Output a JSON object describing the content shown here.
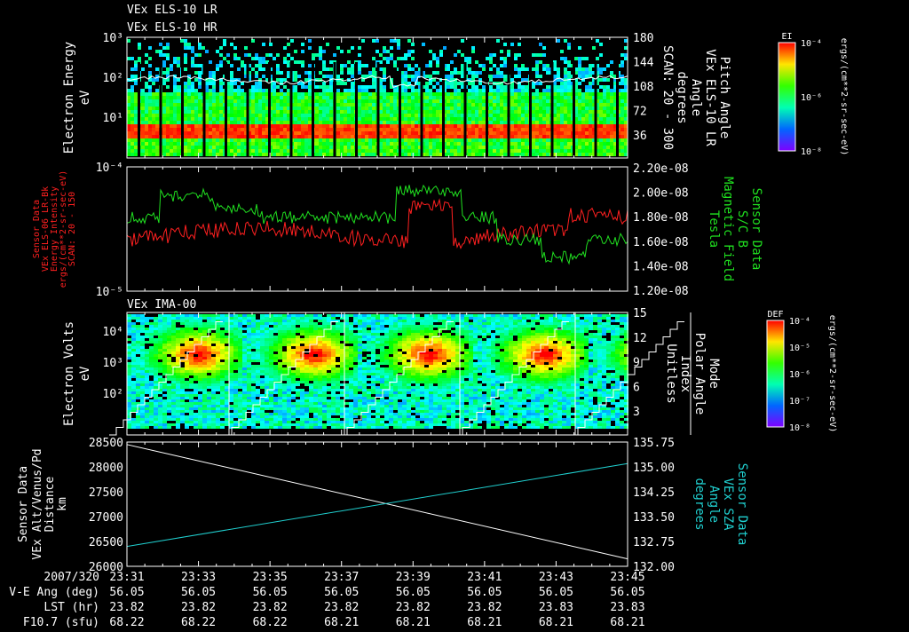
{
  "titles": {
    "top1": "VEx ELS-10 LR",
    "top2": "VEx ELS-10 HR",
    "ima": "VEx IMA-00"
  },
  "colors": {
    "red": "#ff2020",
    "green": "#20e020",
    "cyan": "#20d0d0",
    "white": "#ffffff"
  },
  "panel1": {
    "left_label": [
      "Electron Energy",
      "eV"
    ],
    "left_ticks": [
      "10³",
      "10²",
      "10¹"
    ],
    "right_ticks": [
      "180",
      "144",
      "108",
      "72",
      "36"
    ],
    "right_label": [
      "Pitch Angle",
      "VEx ELS-10 LR",
      "Angle",
      "degrees",
      "SCAN: 20 - 300"
    ],
    "colorbar": {
      "title": "EI",
      "ticks": [
        "10⁻⁴",
        "10⁻⁶",
        "10⁻⁸"
      ],
      "unit": "ergs/(cm**2-sr-sec-eV)"
    }
  },
  "panel2": {
    "left_ticks": [
      "10⁻⁴",
      "10⁻⁵"
    ],
    "left_label": [
      "Sensor Data",
      "VEx ELS-06 LR-Bk",
      "Energy Intensity",
      "ergs/(cm**2-sr-sec-eV)",
      "SCAN: 20 - 150"
    ],
    "right_ticks": [
      "2.20e-08",
      "2.00e-08",
      "1.80e-08",
      "1.60e-08",
      "1.40e-08",
      "1.20e-08"
    ],
    "right_label": [
      "Sensor Data",
      "S/C B",
      "Magnetic Field",
      "Tesla"
    ]
  },
  "panel3": {
    "left_label": [
      "Electron Volts",
      "eV"
    ],
    "left_ticks": [
      "10⁴",
      "10³",
      "10²"
    ],
    "right_ticks": [
      "15",
      "12",
      "9",
      "6",
      "3"
    ],
    "right_label": [
      "Mode",
      "Polar Angle",
      "Index",
      "Unitless"
    ],
    "colorbar": {
      "title": "DEF",
      "ticks": [
        "10⁻⁴",
        "10⁻⁵",
        "10⁻⁶",
        "10⁻⁷",
        "10⁻⁸"
      ],
      "unit": "ergs/(cm**2-sr-sec-eV)"
    }
  },
  "chart_data": {
    "type": "line",
    "title": "Sensor Data",
    "left_axis": {
      "label": "Sensor Data VEx Alt/Venus/Pd Distance km",
      "ticks": [
        "28500",
        "28000",
        "27500",
        "27000",
        "26500",
        "26000"
      ],
      "ylim": [
        26000,
        28500
      ]
    },
    "right_axis": {
      "label": "Sensor Data VEx SZA Angle degrees",
      "ticks": [
        "135.75",
        "135.00",
        "134.25",
        "133.50",
        "132.75",
        "132.00"
      ],
      "ylim": [
        132.0,
        135.75
      ]
    },
    "x": [
      "23:31",
      "23:45"
    ],
    "series": [
      {
        "name": "Distance (km)",
        "color": "#ffffff",
        "values": [
          28450,
          26150
        ]
      },
      {
        "name": "SZA (deg)",
        "color": "#20d0d0",
        "values": [
          132.6,
          135.1
        ]
      }
    ]
  },
  "footer": {
    "row_labels": [
      "2007/320",
      "V-E Ang (deg)",
      "LST (hr)",
      "F10.7 (sfu)"
    ],
    "times": [
      "23:31",
      "23:33",
      "23:35",
      "23:37",
      "23:39",
      "23:41",
      "23:43",
      "23:45"
    ],
    "ve_ang": [
      "56.05",
      "56.05",
      "56.05",
      "56.05",
      "56.05",
      "56.05",
      "56.05",
      "56.05"
    ],
    "lst": [
      "23.82",
      "23.82",
      "23.82",
      "23.82",
      "23.82",
      "23.82",
      "23.83",
      "23.83"
    ],
    "f107": [
      "68.22",
      "68.22",
      "68.22",
      "68.21",
      "68.21",
      "68.21",
      "68.21",
      "68.21"
    ]
  }
}
